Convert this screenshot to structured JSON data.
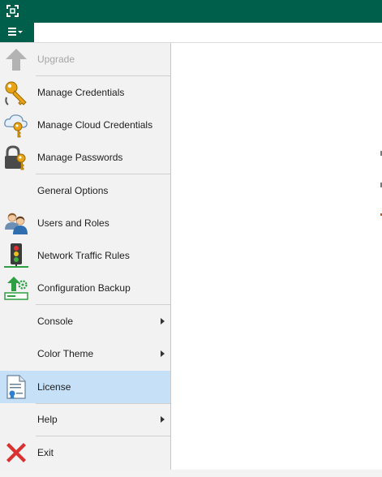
{
  "titlebar": {
    "app_icon": "veeam-app-icon",
    "color": "#005f4b"
  },
  "toolbar": {
    "menu_button_icon": "hamburger-dropdown-icon"
  },
  "menu": {
    "items": [
      {
        "label": "Upgrade",
        "icon": "up-arrow-icon",
        "disabled": true
      },
      {
        "label": "Manage Credentials",
        "icon": "key-icon"
      },
      {
        "label": "Manage Cloud Credentials",
        "icon": "cloud-key-icon"
      },
      {
        "label": "Manage Passwords",
        "icon": "lock-key-icon"
      },
      {
        "label": "General Options",
        "icon": "none"
      },
      {
        "label": "Users and Roles",
        "icon": "users-icon"
      },
      {
        "label": "Network Traffic Rules",
        "icon": "traffic-light-icon"
      },
      {
        "label": "Configuration Backup",
        "icon": "config-backup-icon"
      },
      {
        "label": "Console",
        "icon": "none",
        "submenu": true
      },
      {
        "label": "Color Theme",
        "icon": "none",
        "submenu": true
      },
      {
        "label": "License",
        "icon": "license-icon",
        "selected": true
      },
      {
        "label": "Help",
        "icon": "none",
        "submenu": true
      },
      {
        "label": "Exit",
        "icon": "close-x-icon"
      }
    ]
  },
  "colors": {
    "selected": "#c5e0f7",
    "disabled_text": "#a6a6a6",
    "brand": "#005f4b"
  }
}
